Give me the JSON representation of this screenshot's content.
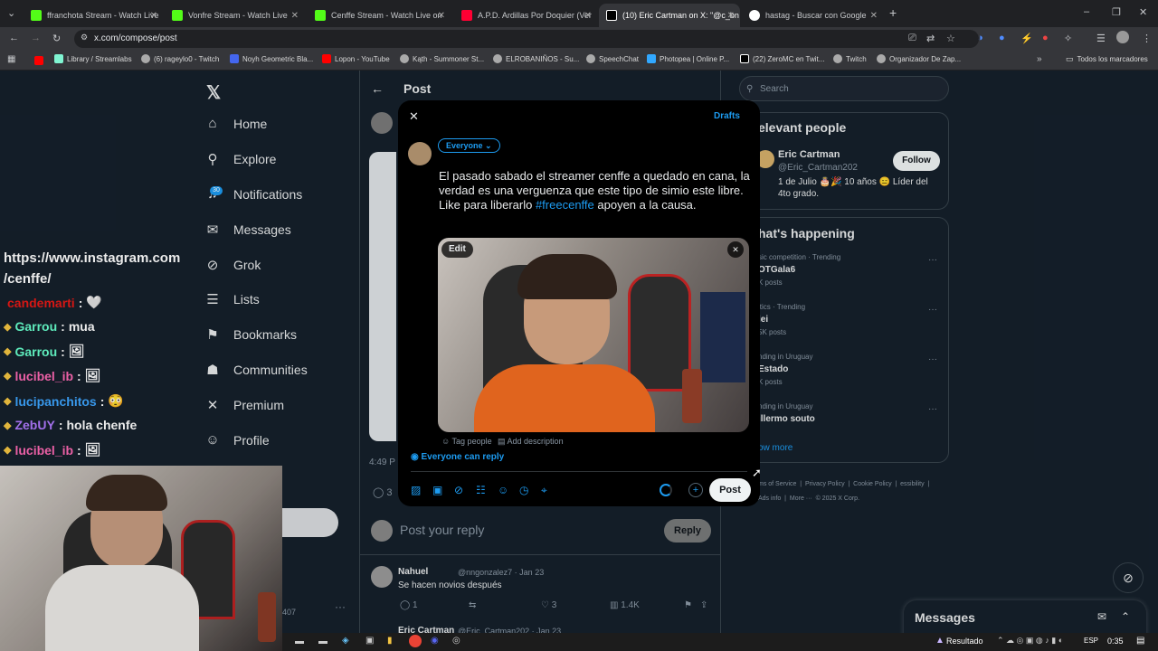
{
  "tabs": [
    {
      "label": "ffranchota Stream - Watch Live",
      "color": "#53fc18"
    },
    {
      "label": "Vonfre Stream - Watch Live",
      "color": "#53fc18"
    },
    {
      "label": "Cenffe Stream - Watch Live on",
      "color": "#53fc18"
    },
    {
      "label": "A.P.D. Ardillas Por Doquier (Ver",
      "color": "#ff0033"
    },
    {
      "label": "(10) Eric Cartman on X: \"@c_bn",
      "color": "#ffffff"
    },
    {
      "label": "hastag - Buscar con Google",
      "color": "#4285f4"
    }
  ],
  "address": "x.com/compose/post",
  "bookmarks": [
    "Library / Streamlabs",
    "(6) rageylo0 - Twitch",
    "Noyh Geometric Bla...",
    "Lopon - YouTube",
    "Kąth - Summoner St...",
    "ELROBANIÑOS - Su...",
    "SpeechChat",
    "Photopea | Online P...",
    "(22) ZeroMC en Twit...",
    "Twitch",
    "Organizador De Zap...",
    "Todos los marcadores"
  ],
  "nav": [
    {
      "label": "Home",
      "icon": "home-icon",
      "glyph": "⌂"
    },
    {
      "label": "Explore",
      "icon": "search-icon",
      "glyph": "⚲"
    },
    {
      "label": "Notifications",
      "icon": "bell-icon",
      "glyph": "♫"
    },
    {
      "label": "Messages",
      "icon": "mail-icon",
      "glyph": "✉"
    },
    {
      "label": "Grok",
      "icon": "grok-icon",
      "glyph": "⊘"
    },
    {
      "label": "Lists",
      "icon": "lists-icon",
      "glyph": "☰"
    },
    {
      "label": "Bookmarks",
      "icon": "bookmark-icon",
      "glyph": "⚑"
    },
    {
      "label": "Communities",
      "icon": "communities-icon",
      "glyph": "☗"
    },
    {
      "label": "Premium",
      "icon": "x-icon",
      "glyph": "✕"
    },
    {
      "label": "Profile",
      "icon": "profile-icon",
      "glyph": "☺"
    }
  ],
  "notif_badge": "30",
  "chat": {
    "url": "https://www.instagram.com\n/cenffe/",
    "lines": [
      {
        "user": "candemarti",
        "sep": ":",
        "msg": "🤍",
        "color": "#e91916"
      },
      {
        "user": "Garrou",
        "sep": ":",
        "msg": "mua",
        "color": "#66ffcc"
      },
      {
        "user": "Garrou",
        "sep": ":",
        "msg": "🖼",
        "color": "#66ffcc"
      },
      {
        "user": "lucibel_ib",
        "sep": ":",
        "msg": "🖼",
        "color": "#ff69b4"
      },
      {
        "user": "lucipanchitos",
        "sep": ":",
        "msg": "😳",
        "color": "#3da5ff"
      },
      {
        "user": "ZebUY",
        "sep": ":",
        "msg": "hola chenfe",
        "color": "#b07aff"
      },
      {
        "user": "lucibel_ib",
        "sep": ":",
        "msg": "🖼",
        "color": "#ff69b4"
      }
    ]
  },
  "main": {
    "header": "Post",
    "time": "4:49 P",
    "reply_placeholder": "Post your reply",
    "reply_button": "Reply",
    "reply1": {
      "name": "Nahuel",
      "handle": "@nngonzalez7 · Jan 23",
      "text": "Se hacen novios después",
      "replies": "1",
      "likes": "3",
      "views": "1.4K"
    },
    "reply2": {
      "name": "Eric Cartman",
      "handle": "@Eric_Cartman202 · Jan 23"
    }
  },
  "modal": {
    "drafts": "Drafts",
    "audience": "Everyone",
    "text_before": "El pasado sabado el streamer cenffe a quedado en cana, la verdad es una verguenza que este tipo de simio este libre. Like para liberarlo ",
    "hashtag": "#freecenffe",
    "text_after": " apoyen a la causa.",
    "edit": "Edit",
    "tag_people": "Tag people",
    "add_description": "Add description",
    "reply_setting": "Everyone can reply",
    "post_button": "Post"
  },
  "right": {
    "search_placeholder": "Search",
    "relevant_title": "elevant people",
    "person_name": "Eric Cartman",
    "person_handle": "@Eric_Cartman202",
    "follow": "Follow",
    "bio": "1 de Julio 🎂🎉 10 años 😑 Líder del 4to grado.",
    "happening_title": "hat's happening",
    "trends": [
      {
        "meta": "sic competition · Trending",
        "name": "OTGala6",
        "posts": "K posts"
      },
      {
        "meta": "itics · Trending",
        "name": "lei",
        "posts": "5K posts"
      },
      {
        "meta": "nding in Uruguay",
        "name": "Estado",
        "posts": "K posts"
      },
      {
        "meta": "nding in Uruguay",
        "name": "illermo souto",
        "posts": ""
      }
    ],
    "show_more": "ow more",
    "footer": "ms of Service  |  Privacy Policy  |  Cookie Policy  |  essibility  |  Ads info  |  More ···  © 2025 X Corp.",
    "messages": "Messages"
  },
  "taskbar": {
    "result": "Resultado",
    "lang": "ESP",
    "time": "0:35"
  }
}
